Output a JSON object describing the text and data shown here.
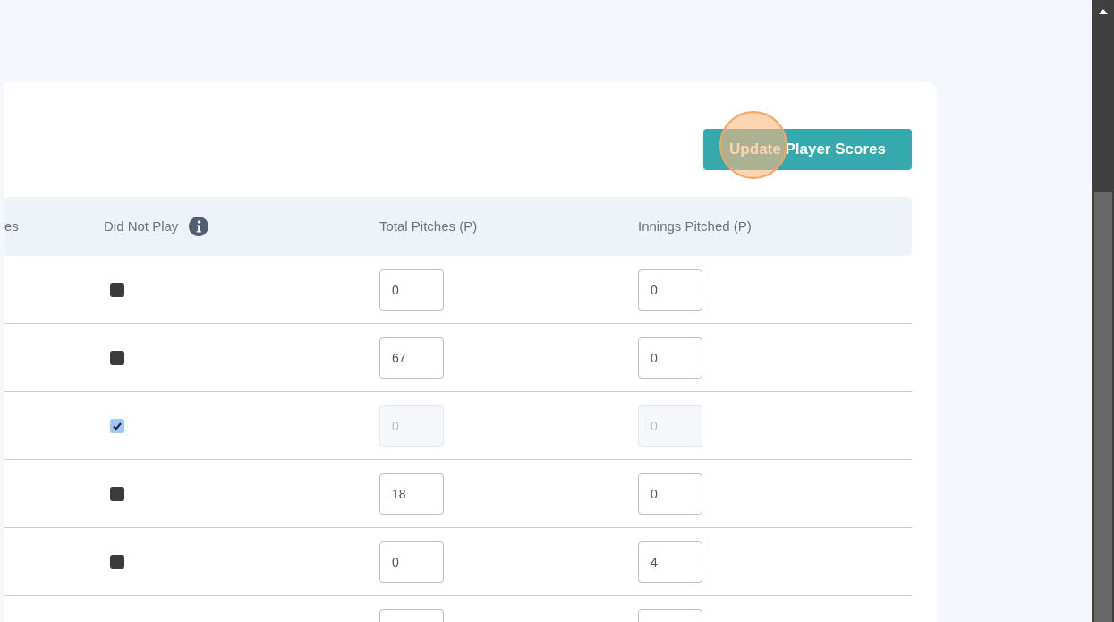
{
  "update_button": {
    "label": "Update Player Scores"
  },
  "table": {
    "columns": [
      {
        "label": "es"
      },
      {
        "label": "Did Not Play",
        "info": true
      },
      {
        "label": "Total Pitches (P)"
      },
      {
        "label": "Innings Pitched (P)"
      }
    ],
    "rows": [
      {
        "did_not_play": false,
        "total_pitches": "0",
        "innings_pitched": "0"
      },
      {
        "did_not_play": false,
        "total_pitches": "67",
        "innings_pitched": "0"
      },
      {
        "did_not_play": true,
        "total_pitches": "0",
        "innings_pitched": "0"
      },
      {
        "did_not_play": false,
        "total_pitches": "18",
        "innings_pitched": "0"
      },
      {
        "did_not_play": false,
        "total_pitches": "0",
        "innings_pitched": "4"
      },
      {}
    ]
  }
}
